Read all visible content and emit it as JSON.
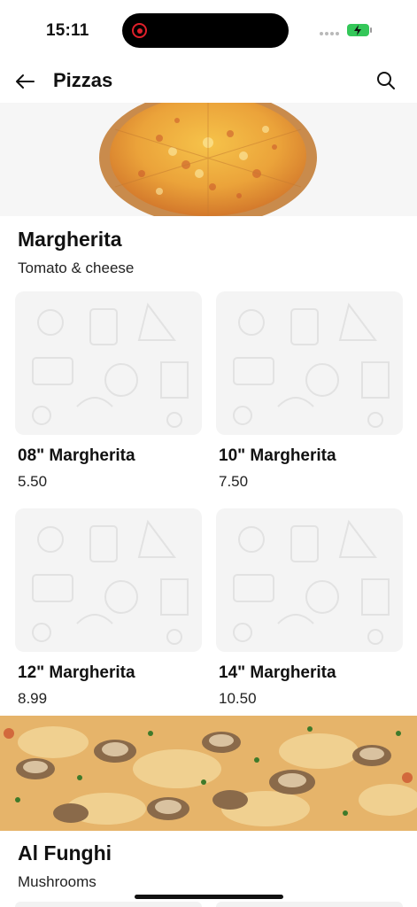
{
  "status_bar": {
    "time": "15:11"
  },
  "nav": {
    "title": "Pizzas",
    "back_icon": "arrow-left-icon",
    "search_icon": "search-icon"
  },
  "sections": [
    {
      "title": "Margherita",
      "subtitle": "Tomato & cheese",
      "items": [
        {
          "name": "08\" Margherita",
          "price": "5.50"
        },
        {
          "name": "10\" Margherita",
          "price": "7.50"
        },
        {
          "name": "12\" Margherita",
          "price": "8.99"
        },
        {
          "name": "14\" Margherita",
          "price": "10.50"
        }
      ]
    },
    {
      "title": "Al Funghi",
      "subtitle": "Mushrooms"
    }
  ],
  "colors": {
    "recording": "#e0202a",
    "battery": "#34c759",
    "placeholder_bg": "#f4f4f4"
  }
}
